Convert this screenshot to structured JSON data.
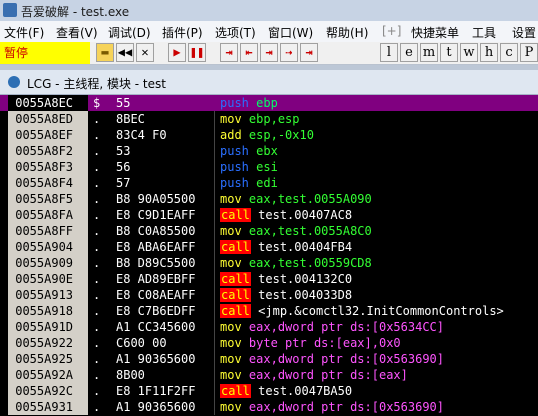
{
  "app": {
    "title": "吾爱破解 - test.exe"
  },
  "menu": {
    "file": "文件(F)",
    "view": "查看(V)",
    "debug": "调试(D)",
    "plugins": "插件(P)",
    "options": "选项(T)",
    "window": "窗口(W)",
    "help": "帮助(H)",
    "plus": "[+]",
    "quickmenu": "快捷菜单",
    "tools": "工具",
    "settings": "设置"
  },
  "toolbar": {
    "status": "暂停",
    "buttons": [
      "▶▶",
      "◀◀",
      "✕",
      "▶",
      "❚❚",
      "⇥",
      "⇤",
      "⇥",
      "⇢",
      "⇥"
    ],
    "letters": [
      "l",
      "e",
      "m",
      "t",
      "w",
      "h",
      "c",
      "P"
    ]
  },
  "window": {
    "title": "LCG - 主线程, 模块 - test"
  },
  "disasm": {
    "rows": [
      {
        "addr": "0055A8EC",
        "mark": "$",
        "hex": "55",
        "mn": "push",
        "ops": "ebp"
      },
      {
        "addr": "0055A8ED",
        "mark": ".",
        "hex": "8BEC",
        "mn": "mov",
        "ops": "ebp,esp"
      },
      {
        "addr": "0055A8EF",
        "mark": ".",
        "hex": "83C4 F0",
        "mn": "add",
        "ops": "esp,-0x10"
      },
      {
        "addr": "0055A8F2",
        "mark": ".",
        "hex": "53",
        "mn": "push",
        "ops": "ebx"
      },
      {
        "addr": "0055A8F3",
        "mark": ".",
        "hex": "56",
        "mn": "push",
        "ops": "esi"
      },
      {
        "addr": "0055A8F4",
        "mark": ".",
        "hex": "57",
        "mn": "push",
        "ops": "edi"
      },
      {
        "addr": "0055A8F5",
        "mark": ".",
        "hex": "B8 90A05500",
        "mn": "mov",
        "ops": "eax,test.0055A090"
      },
      {
        "addr": "0055A8FA",
        "mark": ".",
        "hex": "E8 C9D1EAFF",
        "mn": "call",
        "ops": "test.00407AC8"
      },
      {
        "addr": "0055A8FF",
        "mark": ".",
        "hex": "B8 C0A85500",
        "mn": "mov",
        "ops": "eax,test.0055A8C0"
      },
      {
        "addr": "0055A904",
        "mark": ".",
        "hex": "E8 ABA6EAFF",
        "mn": "call",
        "ops": "test.00404FB4"
      },
      {
        "addr": "0055A909",
        "mark": ".",
        "hex": "B8 D89C5500",
        "mn": "mov",
        "ops": "eax,test.00559CD8"
      },
      {
        "addr": "0055A90E",
        "mark": ".",
        "hex": "E8 AD89EBFF",
        "mn": "call",
        "ops": "test.004132C0"
      },
      {
        "addr": "0055A913",
        "mark": ".",
        "hex": "E8 C08AEAFF",
        "mn": "call",
        "ops": "test.004033D8"
      },
      {
        "addr": "0055A918",
        "mark": ".",
        "hex": "E8 C7B6EDFF",
        "mn": "call",
        "ops": "<jmp.&comctl32.InitCommonControls>"
      },
      {
        "addr": "0055A91D",
        "mark": ".",
        "hex": "A1 CC345600",
        "mn": "mov",
        "ops": "eax,dword ptr ds:[0x5634CC]"
      },
      {
        "addr": "0055A922",
        "mark": ".",
        "hex": "C600 00",
        "mn": "mov",
        "ops": "byte ptr ds:[eax],0x0"
      },
      {
        "addr": "0055A925",
        "mark": ".",
        "hex": "A1 90365600",
        "mn": "mov",
        "ops": "eax,dword ptr ds:[0x563690]"
      },
      {
        "addr": "0055A92A",
        "mark": ".",
        "hex": "8B00",
        "mn": "mov",
        "ops": "eax,dword ptr ds:[eax]"
      },
      {
        "addr": "0055A92C",
        "mark": ".",
        "hex": "E8 1F11F2FF",
        "mn": "call",
        "ops": "test.0047BA50"
      },
      {
        "addr": "0055A931",
        "mark": ".",
        "hex": "A1 90365600",
        "mn": "mov",
        "ops": "eax,dword ptr ds:[0x563690]"
      }
    ]
  }
}
